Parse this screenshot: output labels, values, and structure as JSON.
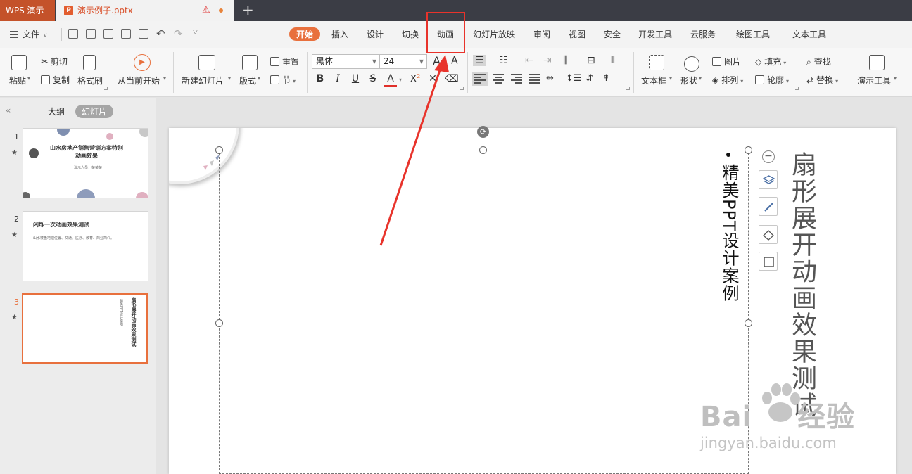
{
  "titlebar": {
    "app_name": "WPS 演示",
    "doc_name": "演示例子.pptx",
    "warn_icon": "⚠",
    "new_tab": "+"
  },
  "menubar": {
    "file_label": "文件",
    "tabs": [
      "开始",
      "插入",
      "设计",
      "切换",
      "动画",
      "幻灯片放映",
      "审阅",
      "视图",
      "安全",
      "开发工具",
      "云服务",
      "绘图工具",
      "文本工具"
    ],
    "active_tab": "开始",
    "highlighted_tab": "动画"
  },
  "ribbon": {
    "paste": "粘贴",
    "cut": "剪切",
    "copy": "复制",
    "format_painter": "格式刷",
    "from_current": "从当前开始",
    "new_slide": "新建幻灯片",
    "layout": "版式",
    "reset": "重置",
    "section": "节",
    "font_name": "黑体",
    "font_size": "24",
    "grow_font": "A",
    "shrink_font": "A",
    "bold": "B",
    "italic": "I",
    "underline": "U",
    "strike": "S",
    "font_color": "A",
    "superscript": "X",
    "textbox": "文本框",
    "shape": "形状",
    "picture": "图片",
    "arrange": "排列",
    "fill": "填充",
    "outline": "轮廓",
    "find": "查找",
    "replace": "替换",
    "presentation_tools": "演示工具"
  },
  "leftpanel": {
    "tab_outline": "大纲",
    "tab_slides": "幻灯片",
    "collapse": "«",
    "slides": [
      {
        "num": "1",
        "title": "山水房地产销售营销方案特别动画效果",
        "subtitle": "演示人员：某某某"
      },
      {
        "num": "2",
        "title": "闪烁一次动画效果测试",
        "body": "山水楼盘地理位置、交通、医疗、教育、商业简介。"
      },
      {
        "num": "3",
        "title": "扇形展开动画效果测试",
        "subtitle": "精美PPT设计案例"
      }
    ]
  },
  "slide": {
    "title": "扇形展开动画效果测试",
    "subtitle": "精美PPT设计案例",
    "rotate_icon": "⟳",
    "minus": "−"
  },
  "watermark": {
    "brand_left": "Bai",
    "brand_right": "经验",
    "url": "jingyan.baidu.com"
  },
  "colors": {
    "accent": "#e8703d",
    "highlight": "#e8332b",
    "titlebar": "#3b3d45"
  }
}
